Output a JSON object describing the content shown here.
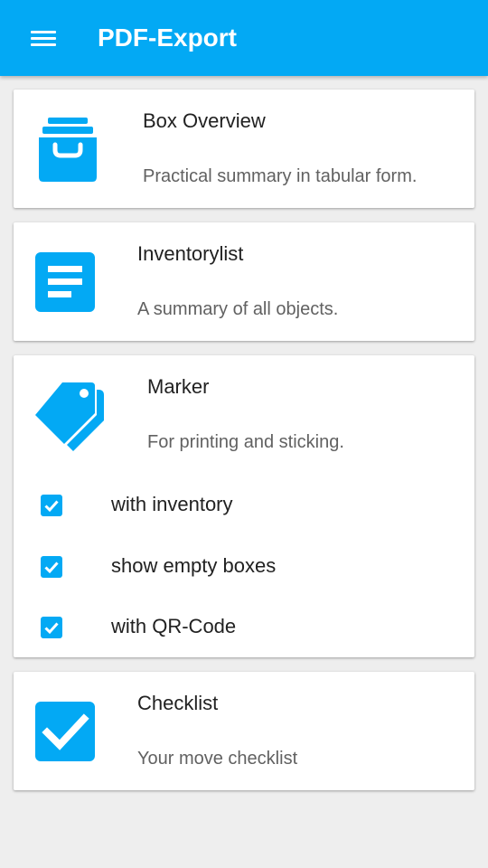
{
  "appbar": {
    "title": "PDF-Export",
    "menu_icon": "hamburger-menu-icon",
    "color": "#03a9f4"
  },
  "cards": [
    {
      "icon": "archive-drawer-icon",
      "title": "Box Overview",
      "subtitle": "Practical summary in tabular form."
    },
    {
      "icon": "document-list-icon",
      "title": "Inventorylist",
      "subtitle": "A summary of all objects."
    },
    {
      "icon": "tags-icon",
      "title": "Marker",
      "subtitle": "For printing and sticking.",
      "options": [
        {
          "label": "with inventory",
          "checked": true
        },
        {
          "label": "show empty boxes",
          "checked": true
        },
        {
          "label": "with QR-Code",
          "checked": true
        }
      ]
    },
    {
      "icon": "checkbox-checked-icon",
      "title": "Checklist",
      "subtitle": "Your move checklist"
    }
  ],
  "colors": {
    "accent": "#03a9f4",
    "background": "#eeeeee",
    "card": "#ffffff"
  }
}
